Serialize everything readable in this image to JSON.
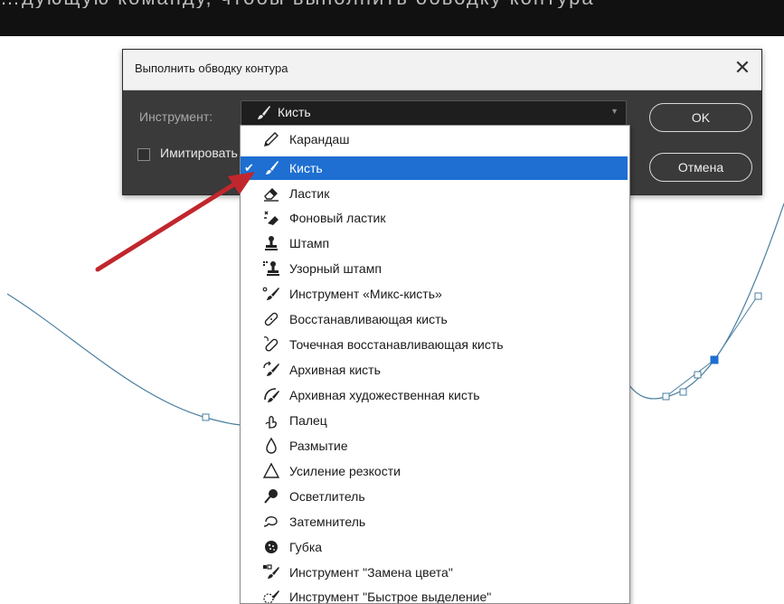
{
  "top_caption": "…дующую команду, чтобы выполнить обводку контура",
  "dialog": {
    "title": "Выполнить обводку контура",
    "close_icon": "close-icon",
    "tool_label": "Инструмент:",
    "tool_value": "Кисть",
    "simulate_label": "Имитировать нажим",
    "simulate_checked": false,
    "ok_label": "OK",
    "cancel_label": "Отмена"
  },
  "dropdown": {
    "selected": "Кисть",
    "items": [
      {
        "label": "Карандаш",
        "icon": "pencil-icon"
      },
      {
        "label": "Кисть",
        "icon": "brush-icon",
        "selected": true
      },
      {
        "label": "Ластик",
        "icon": "eraser-icon"
      },
      {
        "label": "Фоновый ластик",
        "icon": "background-eraser-icon"
      },
      {
        "label": "Штамп",
        "icon": "stamp-icon"
      },
      {
        "label": "Узорный штамп",
        "icon": "pattern-stamp-icon"
      },
      {
        "label": "Инструмент «Микс-кисть»",
        "icon": "mixer-brush-icon"
      },
      {
        "label": "Восстанавливающая кисть",
        "icon": "healing-brush-icon"
      },
      {
        "label": "Точечная восстанавливающая кисть",
        "icon": "spot-healing-brush-icon"
      },
      {
        "label": "Архивная кисть",
        "icon": "history-brush-icon"
      },
      {
        "label": "Архивная художественная кисть",
        "icon": "art-history-brush-icon"
      },
      {
        "label": "Палец",
        "icon": "smudge-icon"
      },
      {
        "label": "Размытие",
        "icon": "blur-icon"
      },
      {
        "label": "Усиление резкости",
        "icon": "sharpen-icon"
      },
      {
        "label": "Осветлитель",
        "icon": "dodge-icon"
      },
      {
        "label": "Затемнитель",
        "icon": "burn-icon"
      },
      {
        "label": "Губка",
        "icon": "sponge-icon"
      },
      {
        "label": "Инструмент \"Замена цвета\"",
        "icon": "color-replacement-icon"
      },
      {
        "label": "Инструмент \"Быстрое выделение\"",
        "icon": "quick-selection-icon"
      }
    ]
  },
  "colors": {
    "dialog_bg": "#3a3a3a",
    "highlight": "#1e6fd1",
    "path_line": "#4a7fa0",
    "anchor_selected": "#1e6fd1",
    "arrow": "#c0272d"
  }
}
